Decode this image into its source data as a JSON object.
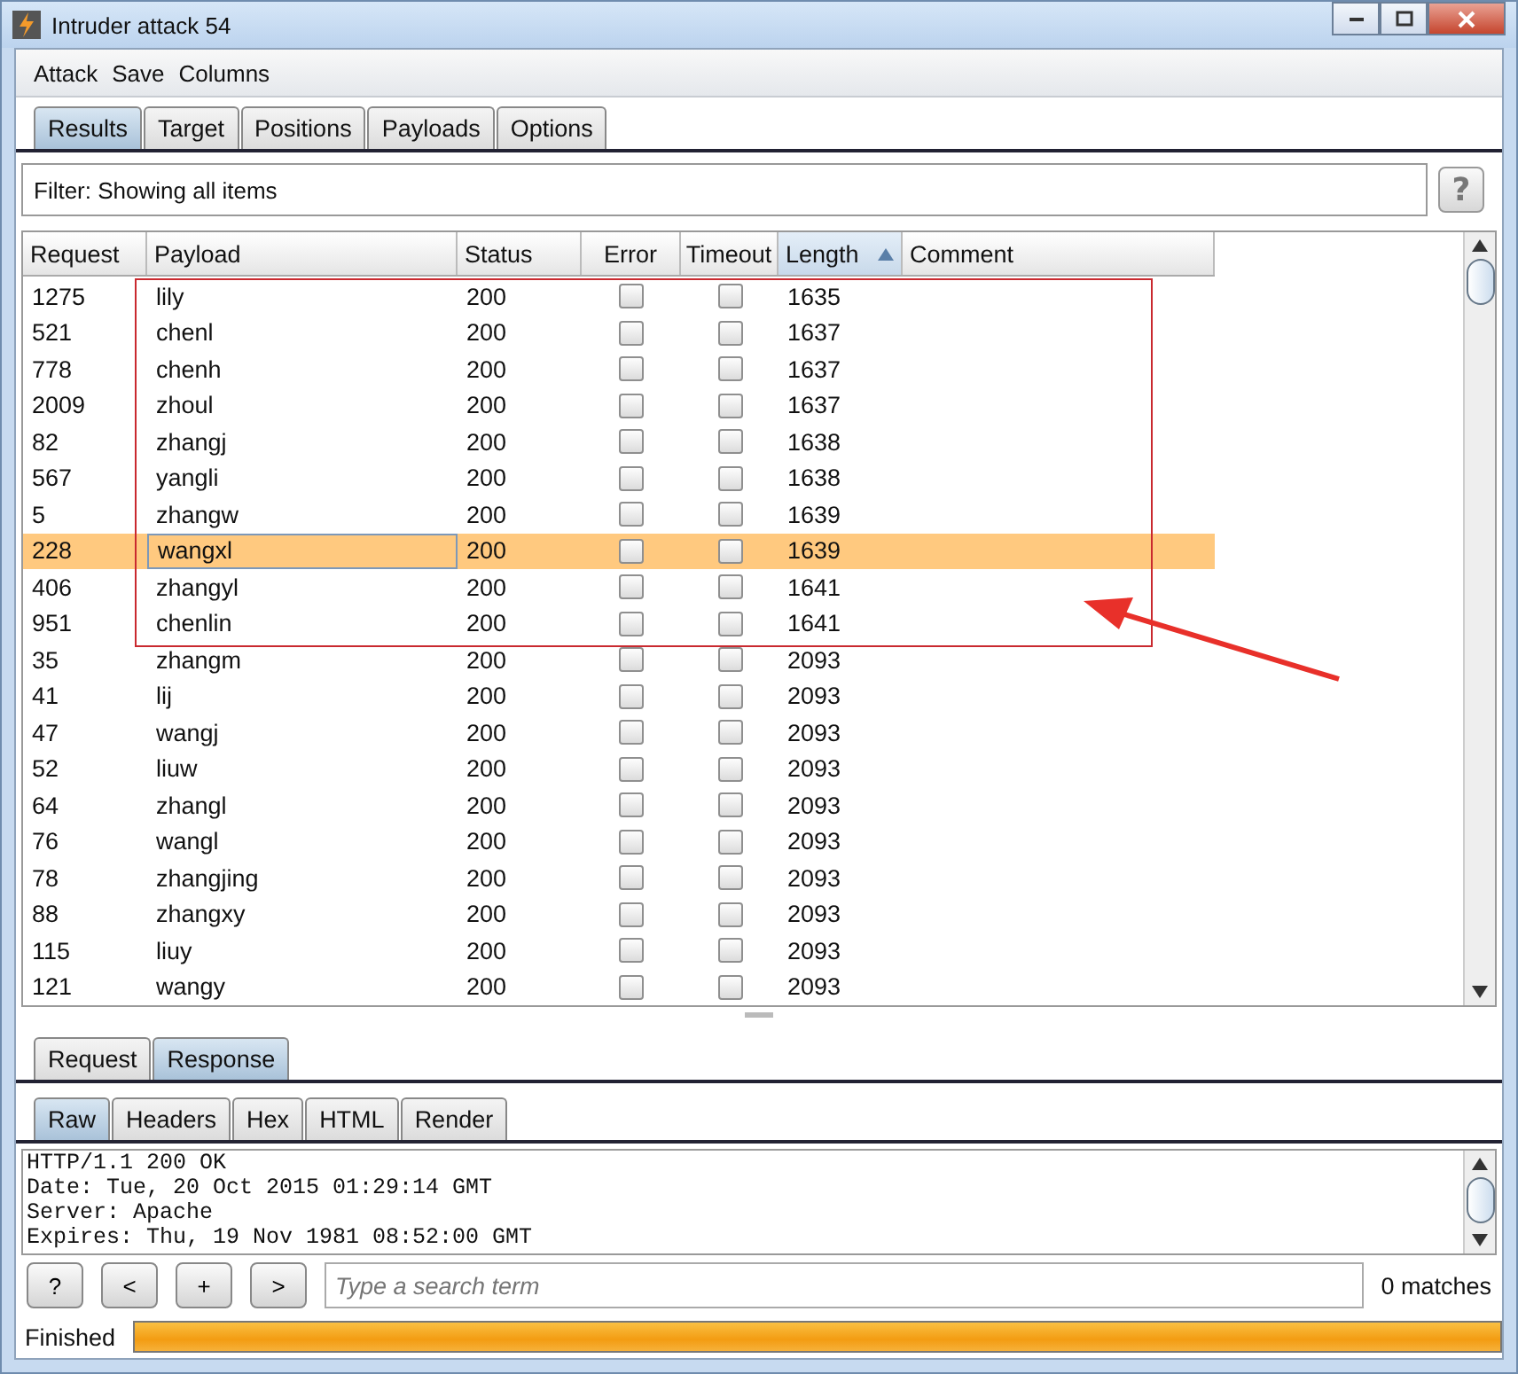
{
  "window": {
    "title": "Intruder attack 54"
  },
  "menu": [
    "Attack",
    "Save",
    "Columns"
  ],
  "tabs": [
    {
      "label": "Results",
      "selected": true
    },
    {
      "label": "Target",
      "selected": false
    },
    {
      "label": "Positions",
      "selected": false
    },
    {
      "label": "Payloads",
      "selected": false
    },
    {
      "label": "Options",
      "selected": false
    }
  ],
  "filter": {
    "text": "Filter: Showing all items",
    "help": "?"
  },
  "table": {
    "columns": [
      {
        "label": "Request",
        "sorted": false
      },
      {
        "label": "Payload",
        "sorted": false
      },
      {
        "label": "Status",
        "sorted": false
      },
      {
        "label": "Error",
        "sorted": false
      },
      {
        "label": "Timeout",
        "sorted": false
      },
      {
        "label": "Length",
        "sorted": true
      },
      {
        "label": "Comment",
        "sorted": false
      }
    ],
    "rows": [
      {
        "request": "1275",
        "payload": "lily",
        "status": "200",
        "error": false,
        "timeout": false,
        "length": "1635",
        "selected": false
      },
      {
        "request": "521",
        "payload": "chenl",
        "status": "200",
        "error": false,
        "timeout": false,
        "length": "1637",
        "selected": false
      },
      {
        "request": "778",
        "payload": "chenh",
        "status": "200",
        "error": false,
        "timeout": false,
        "length": "1637",
        "selected": false
      },
      {
        "request": "2009",
        "payload": "zhoul",
        "status": "200",
        "error": false,
        "timeout": false,
        "length": "1637",
        "selected": false
      },
      {
        "request": "82",
        "payload": "zhangj",
        "status": "200",
        "error": false,
        "timeout": false,
        "length": "1638",
        "selected": false
      },
      {
        "request": "567",
        "payload": "yangli",
        "status": "200",
        "error": false,
        "timeout": false,
        "length": "1638",
        "selected": false
      },
      {
        "request": "5",
        "payload": "zhangw",
        "status": "200",
        "error": false,
        "timeout": false,
        "length": "1639",
        "selected": false
      },
      {
        "request": "228",
        "payload": "wangxl",
        "status": "200",
        "error": false,
        "timeout": false,
        "length": "1639",
        "selected": true
      },
      {
        "request": "406",
        "payload": "zhangyl",
        "status": "200",
        "error": false,
        "timeout": false,
        "length": "1641",
        "selected": false
      },
      {
        "request": "951",
        "payload": "chenlin",
        "status": "200",
        "error": false,
        "timeout": false,
        "length": "1641",
        "selected": false
      },
      {
        "request": "35",
        "payload": "zhangm",
        "status": "200",
        "error": false,
        "timeout": false,
        "length": "2093",
        "selected": false
      },
      {
        "request": "41",
        "payload": "lij",
        "status": "200",
        "error": false,
        "timeout": false,
        "length": "2093",
        "selected": false
      },
      {
        "request": "47",
        "payload": "wangj",
        "status": "200",
        "error": false,
        "timeout": false,
        "length": "2093",
        "selected": false
      },
      {
        "request": "52",
        "payload": "liuw",
        "status": "200",
        "error": false,
        "timeout": false,
        "length": "2093",
        "selected": false
      },
      {
        "request": "64",
        "payload": "zhangl",
        "status": "200",
        "error": false,
        "timeout": false,
        "length": "2093",
        "selected": false
      },
      {
        "request": "76",
        "payload": "wangl",
        "status": "200",
        "error": false,
        "timeout": false,
        "length": "2093",
        "selected": false
      },
      {
        "request": "78",
        "payload": "zhangjing",
        "status": "200",
        "error": false,
        "timeout": false,
        "length": "2093",
        "selected": false
      },
      {
        "request": "88",
        "payload": "zhangxy",
        "status": "200",
        "error": false,
        "timeout": false,
        "length": "2093",
        "selected": false
      },
      {
        "request": "115",
        "payload": "liuy",
        "status": "200",
        "error": false,
        "timeout": false,
        "length": "2093",
        "selected": false
      },
      {
        "request": "121",
        "payload": "wangy",
        "status": "200",
        "error": false,
        "timeout": false,
        "length": "2093",
        "selected": false
      }
    ]
  },
  "message_tabs": [
    {
      "label": "Request",
      "selected": false
    },
    {
      "label": "Response",
      "selected": true
    }
  ],
  "view_tabs": [
    {
      "label": "Raw",
      "selected": true
    },
    {
      "label": "Headers",
      "selected": false
    },
    {
      "label": "Hex",
      "selected": false
    },
    {
      "label": "HTML",
      "selected": false
    },
    {
      "label": "Render",
      "selected": false
    }
  ],
  "response_lines": [
    "HTTP/1.1 200 OK",
    "Date: Tue, 20 Oct 2015 01:29:14 GMT",
    "Server: Apache",
    "Expires: Thu, 19 Nov 1981 08:52:00 GMT"
  ],
  "search": {
    "buttons": [
      "?",
      "<",
      "+",
      ">"
    ],
    "placeholder": "Type a search term",
    "matches": "0 matches"
  },
  "status_bar": {
    "text": "Finished",
    "level": 1
  }
}
